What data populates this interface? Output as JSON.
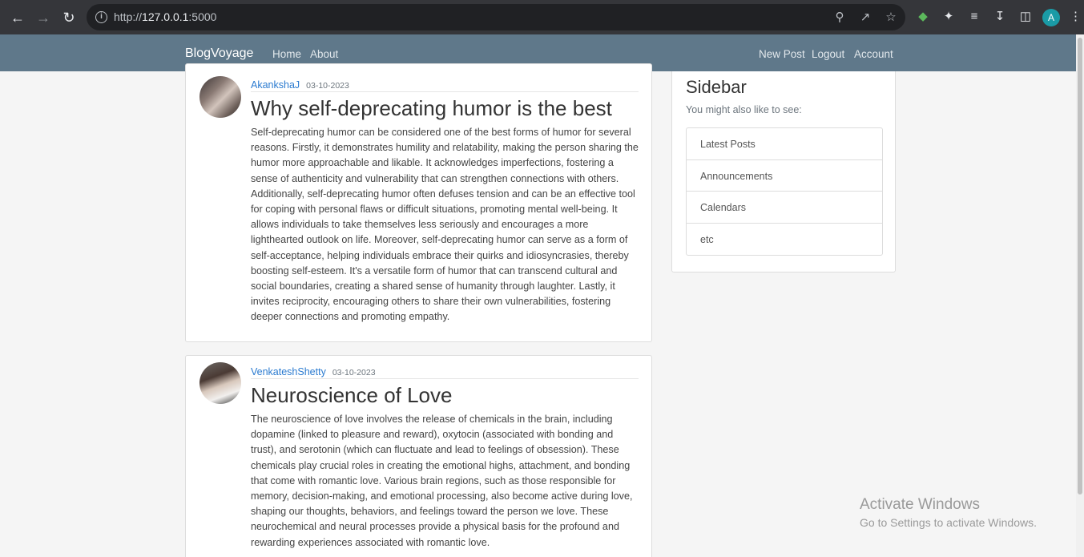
{
  "browser": {
    "url_scheme": "http://",
    "url_host": "127.0.0.1",
    "url_port": ":5000",
    "profile_initial": "A"
  },
  "navbar": {
    "brand": "BlogVoyage",
    "left_links": [
      "Home",
      "About"
    ],
    "right_links": [
      "New Post",
      "Logout",
      "Account"
    ],
    "color": "#5f788a"
  },
  "posts": [
    {
      "author": "AkankshaJ",
      "date": "03-10-2023",
      "title": "Why self-deprecating humor is the best",
      "body": "Self-deprecating humor can be considered one of the best forms of humor for several reasons. Firstly, it demonstrates humility and relatability, making the person sharing the humor more approachable and likable. It acknowledges imperfections, fostering a sense of authenticity and vulnerability that can strengthen connections with others. Additionally, self-deprecating humor often defuses tension and can be an effective tool for coping with personal flaws or difficult situations, promoting mental well-being. It allows individuals to take themselves less seriously and encourages a more lighthearted outlook on life. Moreover, self-deprecating humor can serve as a form of self-acceptance, helping individuals embrace their quirks and idiosyncrasies, thereby boosting self-esteem. It's a versatile form of humor that can transcend cultural and social boundaries, creating a shared sense of humanity through laughter. Lastly, it invites reciprocity, encouraging others to share their own vulnerabilities, fostering deeper connections and promoting empathy."
    },
    {
      "author": "VenkateshShetty",
      "date": "03-10-2023",
      "title": "Neuroscience of Love",
      "body": "The neuroscience of love involves the release of chemicals in the brain, including dopamine (linked to pleasure and reward), oxytocin (associated with bonding and trust), and serotonin (which can fluctuate and lead to feelings of obsession). These chemicals play crucial roles in creating the emotional highs, attachment, and bonding that come with romantic love. Various brain regions, such as those responsible for memory, decision-making, and emotional processing, also become active during love, shaping our thoughts, behaviors, and feelings toward the person we love. These neurochemical and neural processes provide a physical basis for the profound and rewarding experiences associated with romantic love."
    }
  ],
  "sidebar": {
    "title": "Sidebar",
    "subtitle": "You might also like to see:",
    "items": [
      "Latest Posts",
      "Announcements",
      "Calendars",
      "etc"
    ]
  },
  "watermark": {
    "line1": "Activate Windows",
    "line2": "Go to Settings to activate Windows."
  }
}
